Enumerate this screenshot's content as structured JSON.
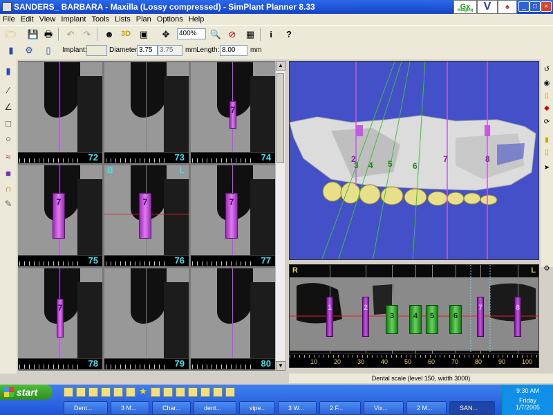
{
  "window": {
    "title": "SANDERS_ BARBARA - Maxilla (Lossy compressed) - SimPlant Planner 8.33",
    "logo_text": "Gx",
    "logo_subtext": "imaging",
    "logo_v": "V",
    "controls": {
      "minimize": "_",
      "maximize": "□",
      "close": "×"
    }
  },
  "menu": [
    "File",
    "Edit",
    "View",
    "Implant",
    "Tools",
    "Lists",
    "Plan",
    "Options",
    "Help"
  ],
  "toolbar": {
    "zoom_value": "400%",
    "btn_3d": "3D",
    "info_icon": "i",
    "help_icon": "?"
  },
  "implant_bar": {
    "implant_label": "Implant:",
    "implant_value": "",
    "diameter_label": "Diameter:",
    "diameter_value": "3.75",
    "diameter_alt": "3.75",
    "diameter_unit": "mm",
    "length_label": "Length:",
    "length_value": "8.00",
    "length_unit": "mm"
  },
  "slices": [
    {
      "num": "72"
    },
    {
      "num": "73"
    },
    {
      "num": "74",
      "implant": "7"
    },
    {
      "num": "75",
      "implant": "7"
    },
    {
      "num": "76",
      "implant": "7"
    },
    {
      "num": "77",
      "implant": "7"
    },
    {
      "num": "78",
      "implant": "7"
    },
    {
      "num": "79"
    },
    {
      "num": "80"
    }
  ],
  "slice_markers": {
    "buccal": "B",
    "lingual": "L"
  },
  "view3d": {
    "implant_labels": [
      "2",
      "3",
      "4",
      "5",
      "6",
      "7",
      "8"
    ]
  },
  "panoramic": {
    "left_marker": "R",
    "right_marker": "L",
    "implants": [
      {
        "label": "1",
        "type": "planned"
      },
      {
        "label": "2",
        "type": "planned"
      },
      {
        "label": "3",
        "type": "placed"
      },
      {
        "label": "4",
        "type": "placed"
      },
      {
        "label": "5",
        "type": "placed"
      },
      {
        "label": "6",
        "type": "placed"
      },
      {
        "label": "7",
        "type": "planned"
      },
      {
        "label": "8",
        "type": "planned"
      }
    ],
    "scale": [
      "10",
      "20",
      "30",
      "40",
      "50",
      "60",
      "70",
      "80",
      "90",
      "100"
    ]
  },
  "status_text": "Dental scale (level 150, width 3000)",
  "taskbar": {
    "start_label": "start",
    "tasks": [
      "Dent...",
      "3 M...",
      "Char...",
      "dent...",
      "vipe...",
      "3 W...",
      "2 F...",
      "Vix...",
      "2 M...",
      "SAN..."
    ],
    "clock_time": "9:30 AM",
    "clock_day": "Friday",
    "clock_date": "1/7/2005"
  },
  "colors": {
    "implant_planned": "#c45ae0",
    "implant_placed": "#3fbf3a",
    "slice_number": "#39e4f0",
    "view3d_bg": "#4450c8"
  }
}
